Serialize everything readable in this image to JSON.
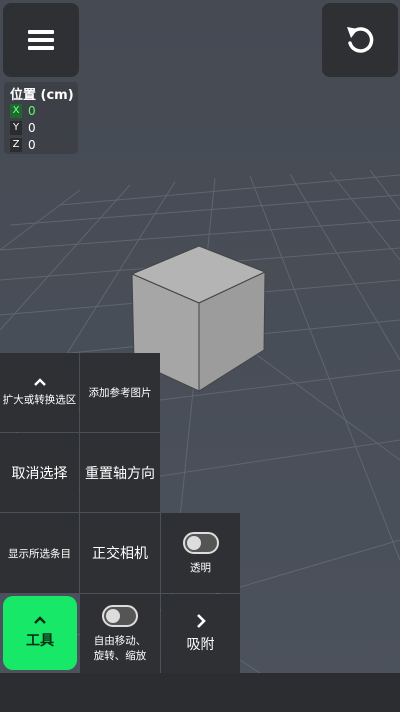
{
  "colors": {
    "accent": "#17e868",
    "panel": "#2f3033",
    "background": "#4a4f58"
  },
  "toolbar": {
    "menu_icon": "hamburger-icon",
    "undo_icon": "undo-icon"
  },
  "position": {
    "title": "位置 (cm)",
    "axes": [
      {
        "axis": "X",
        "value": "0"
      },
      {
        "axis": "Y",
        "value": "0"
      },
      {
        "axis": "Z",
        "value": "0"
      }
    ]
  },
  "tools": {
    "expand_label": "扩大或转换选区",
    "add_ref_label": "添加参考图片",
    "deselect_label": "取消选择",
    "reset_axis_label": "重置轴方向",
    "show_selected_label": "显示所选条目",
    "ortho_camera_label": "正交相机",
    "transparent_label": "透明",
    "tools_label": "工具",
    "free_move_label_1": "自由移动、",
    "free_move_label_2": "旋转、缩放",
    "snap_label": "吸附"
  }
}
